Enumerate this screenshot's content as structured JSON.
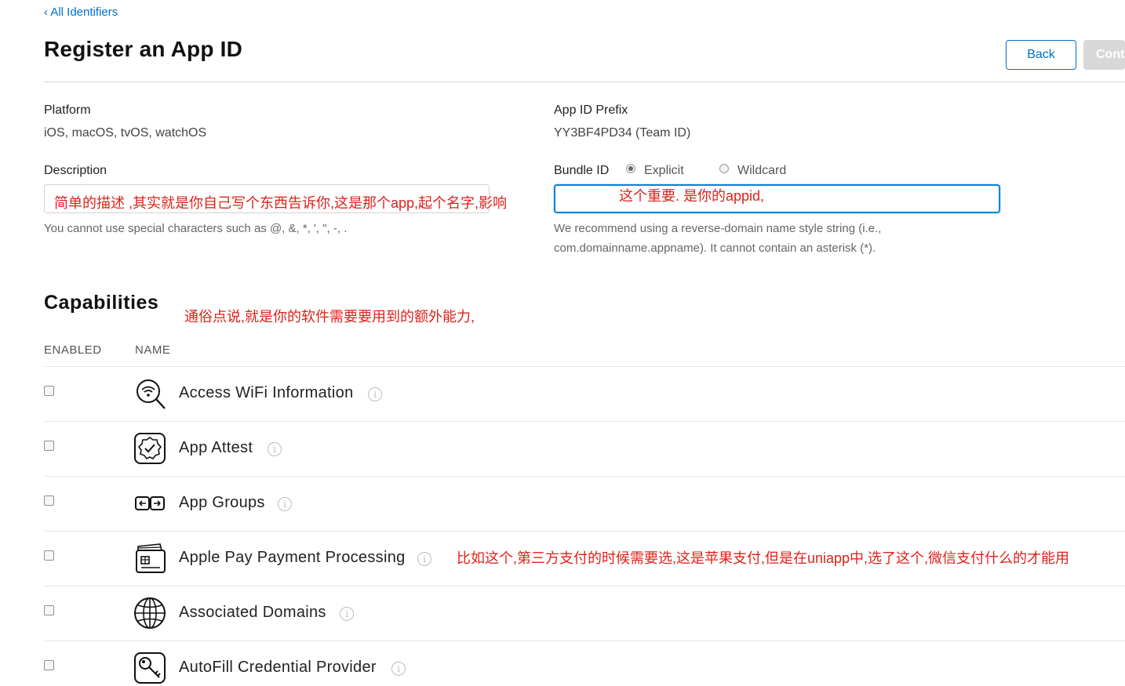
{
  "nav": {
    "back_link": "‹ All Identifiers"
  },
  "header": {
    "title": "Register an App ID",
    "back_button": "Back",
    "continue_button": "Cont"
  },
  "platform": {
    "label": "Platform",
    "value": "iOS, macOS, tvOS, watchOS"
  },
  "prefix": {
    "label": "App ID Prefix",
    "value": "YY3BF4PD34 (Team ID)"
  },
  "description": {
    "label": "Description",
    "value": "",
    "hint": "You cannot use special characters such as @, &, *, ', \", -, ."
  },
  "bundle": {
    "label": "Bundle ID",
    "explicit_label": "Explicit",
    "wildcard_label": "Wildcard",
    "selected": "Explicit",
    "value": "",
    "hint_line1": "We recommend using a reverse-domain name style string (i.e.,",
    "hint_line2": "com.domainname.appname). It cannot contain an asterisk (*)."
  },
  "annotations": {
    "description_note": "简单的描述 ,其实就是你自己写个东西告诉你,这是那个app,起个名字,影响",
    "bundle_note": "这个重要. 是你的appid,",
    "capabilities_note": "通俗点说,就是你的软件需要要用到的额外能力,",
    "apple_pay_note": "比如这个,第三方支付的时候需要选,这是苹果支付,但是在uniapp中,选了这个,微信支付什么的才能用"
  },
  "capabilities": {
    "title": "Capabilities",
    "col_enabled": "ENABLED",
    "col_name": "NAME",
    "items": [
      {
        "name": "Access WiFi Information",
        "icon": "wifi-search-icon",
        "enabled": false
      },
      {
        "name": "App Attest",
        "icon": "verified-badge-icon",
        "enabled": false
      },
      {
        "name": "App Groups",
        "icon": "app-groups-icon",
        "enabled": false
      },
      {
        "name": "Apple Pay Payment Processing",
        "icon": "wallet-card-icon",
        "enabled": false
      },
      {
        "name": "Associated Domains",
        "icon": "globe-icon",
        "enabled": false
      },
      {
        "name": "AutoFill Credential Provider",
        "icon": "key-icon",
        "enabled": false
      }
    ]
  },
  "colors": {
    "accent": "#0070c9",
    "annotation": "#e0211a",
    "disabled_button": "#d8d8d8"
  }
}
